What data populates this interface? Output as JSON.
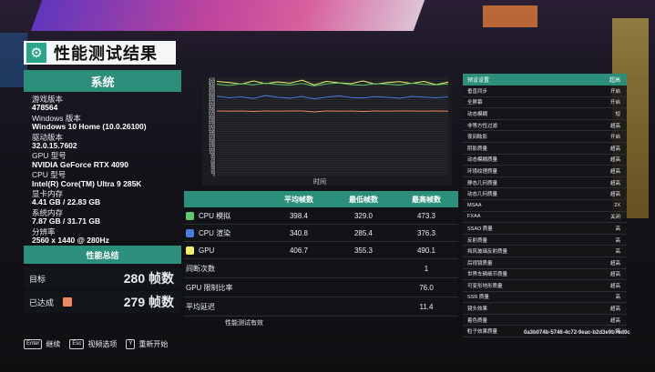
{
  "title": "性能测试结果",
  "system": {
    "header": "系统",
    "items": [
      {
        "label": "游戏版本",
        "value": "478564"
      },
      {
        "label": "Windows 版本",
        "value": "Windows 10 Home (10.0.26100)"
      },
      {
        "label": "驱动版本",
        "value": "32.0.15.7602"
      },
      {
        "label": "GPU 型号",
        "value": "NVIDIA GeForce RTX 4090"
      },
      {
        "label": "CPU 型号",
        "value": "Intel(R) Core(TM) Ultra 9 285K"
      },
      {
        "label": "显卡内存",
        "value": "4.41 GB / 22.83 GB"
      },
      {
        "label": "系统内存",
        "value": "7.87 GB / 31.71 GB"
      },
      {
        "label": "分辨率",
        "value": "2560 x 1440 @ 280Hz"
      }
    ]
  },
  "summary": {
    "header": "性能总结",
    "target_label": "目标",
    "target_value": "280 帧数",
    "achieved_label": "已达成",
    "achieved_value": "279 帧数",
    "achieved_color": "#f08a5d"
  },
  "chart_data": {
    "type": "line",
    "xlabel": "时间",
    "y_ticks": [
      "420",
      "410",
      "400",
      "390",
      "380",
      "370",
      "360",
      "350",
      "340",
      "330",
      "320",
      "310",
      "300",
      "290",
      "280",
      "270",
      "260",
      "250",
      "240",
      "230",
      "220",
      "210",
      "200",
      "190",
      "180",
      "170",
      "160",
      "150",
      "140",
      "130",
      "120",
      "110",
      "100",
      "90",
      "80",
      "70",
      "60",
      "50",
      "40",
      "30",
      "20",
      "10",
      "0"
    ],
    "ylim": [
      0,
      420
    ],
    "series": [
      {
        "color": "#f2f06a",
        "values": [
          410,
          405,
          398,
          412,
          400,
          408,
          402,
          415,
          395,
          410,
          404,
          400,
          412,
          398,
          405,
          409,
          401,
          410,
          396,
          407
        ]
      },
      {
        "color": "#4b7be0",
        "values": [
          345,
          338,
          342,
          335,
          348,
          340,
          336,
          344,
          333,
          341,
          346,
          339,
          337,
          343,
          340,
          336,
          344,
          341,
          338,
          342
        ]
      },
      {
        "color": "#5ec96a",
        "values": [
          398,
          392,
          400,
          395,
          402,
          397,
          394,
          401,
          390,
          399,
          403,
          396,
          393,
          400,
          398,
          394,
          402,
          397,
          395,
          399
        ]
      },
      {
        "color": "#f08a5d",
        "values": [
          280,
          279,
          280,
          278,
          280,
          279,
          280,
          280,
          276,
          280,
          279,
          280,
          278,
          280,
          279,
          280,
          280,
          279,
          280,
          279
        ]
      }
    ]
  },
  "table": {
    "headers": [
      "平均帧数",
      "最低帧数",
      "最高帧数"
    ],
    "rows": [
      {
        "name": "CPU 模拟",
        "color": "#5ec96a",
        "avg": "398.4",
        "min": "329.0",
        "max": "473.3"
      },
      {
        "name": "CPU 渲染",
        "color": "#4b7be0",
        "avg": "340.8",
        "min": "285.4",
        "max": "376.3"
      },
      {
        "name": "GPU",
        "color": "#f2f06a",
        "avg": "406.7",
        "min": "355.3",
        "max": "490.1"
      }
    ],
    "stats": [
      {
        "name": "间断次数",
        "value": "1"
      },
      {
        "name": "GPU 限制比率",
        "value": "76.0"
      },
      {
        "name": "平均延迟",
        "value": "11.4"
      }
    ],
    "valid_text": "性能测试有效"
  },
  "settings": {
    "header_label": "预设设置",
    "header_value": "超高",
    "rows": [
      {
        "label": "垂直同步",
        "value": "开启"
      },
      {
        "label": "全屏幕",
        "value": "开启"
      },
      {
        "label": "动态模糊",
        "value": "短"
      },
      {
        "label": "非等方性过滤",
        "value": "超高"
      },
      {
        "label": "夜间眩影",
        "value": "开启"
      },
      {
        "label": "阴影质量",
        "value": "超高"
      },
      {
        "label": "动态模糊质量",
        "value": "超高"
      },
      {
        "label": "环境纹理质量",
        "value": "超高"
      },
      {
        "label": "静态几何质量",
        "value": "超高"
      },
      {
        "label": "动态几何质量",
        "value": "超高"
      },
      {
        "label": "MSAA",
        "value": "2X"
      },
      {
        "label": "FXAA",
        "value": "关闭"
      },
      {
        "label": "SSAO 质量",
        "value": "高"
      },
      {
        "label": "反射质量",
        "value": "高"
      },
      {
        "label": "挡风玻璃反射质量",
        "value": "高"
      },
      {
        "label": "后视镜质量",
        "value": "超高"
      },
      {
        "label": "世界车辆细节质量",
        "value": "超高"
      },
      {
        "label": "可变形地形质量",
        "value": "超高"
      },
      {
        "label": "SSR 质量",
        "value": "高"
      },
      {
        "label": "镜头效果",
        "value": "超高"
      },
      {
        "label": "着色质量",
        "value": "超高"
      },
      {
        "label": "粒子效果质量",
        "value": "高"
      }
    ],
    "guid": "0a3b074b-5746-4c72-9eac-b2d3e9b76d0c"
  },
  "footer": [
    {
      "key": "Enter",
      "label": "继续"
    },
    {
      "key": "Esc",
      "label": "视频选项"
    },
    {
      "key": "Y",
      "label": "重新开始"
    }
  ]
}
